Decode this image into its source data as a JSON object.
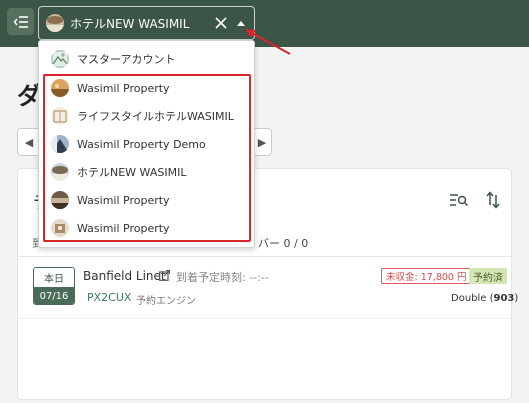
{
  "header": {
    "menu_icon": "menu-collapse-icon",
    "selected_property": "ホテルNEW WASIMIL",
    "clear_icon": "close-icon",
    "caret_icon": "caret-up-icon"
  },
  "dropdown": {
    "items": [
      {
        "label": "マスターアカウント",
        "icon": "mountain-icon"
      },
      {
        "label": "Wasimil Property",
        "icon": "property-thumbnail-icon"
      },
      {
        "label": "ライフスタイルホテルWASIMIL",
        "icon": "property-thumbnail-icon"
      },
      {
        "label": "Wasimil Property Demo",
        "icon": "property-thumbnail-icon"
      },
      {
        "label": "ホテルNEW WASIMIL",
        "icon": "property-thumbnail-icon"
      },
      {
        "label": "Wasimil Property",
        "icon": "property-thumbnail-icon"
      },
      {
        "label": "Wasimil Property",
        "icon": "property-thumbnail-icon"
      }
    ]
  },
  "page": {
    "title_partial": "ダ",
    "nav_prev": "◀",
    "nav_next": "▶"
  },
  "card": {
    "title_partial": "ラ",
    "tab_partial": "到",
    "counter_text": "バー 0 / 0",
    "filter_icon": "search-filter-icon",
    "sort_icon": "sort-icon"
  },
  "reservation": {
    "date_label": "本日",
    "date": "07/16",
    "guest_name": "Banfield Linet",
    "arrival_text": "到着予定時刻: --:--",
    "code": "PX2CUX",
    "channel": "予約エンジン",
    "unpaid": "未収金: 17,800 円",
    "status": "予約済",
    "room_type": "Double (",
    "room_number": "903",
    "room_close": ")"
  },
  "colors": {
    "header_bg": "#3b5546",
    "accent_green": "#4b6b59",
    "highlight_red": "#d8262a",
    "unpaid_red": "#d84a4a",
    "status_bg": "#d4e6b4"
  }
}
